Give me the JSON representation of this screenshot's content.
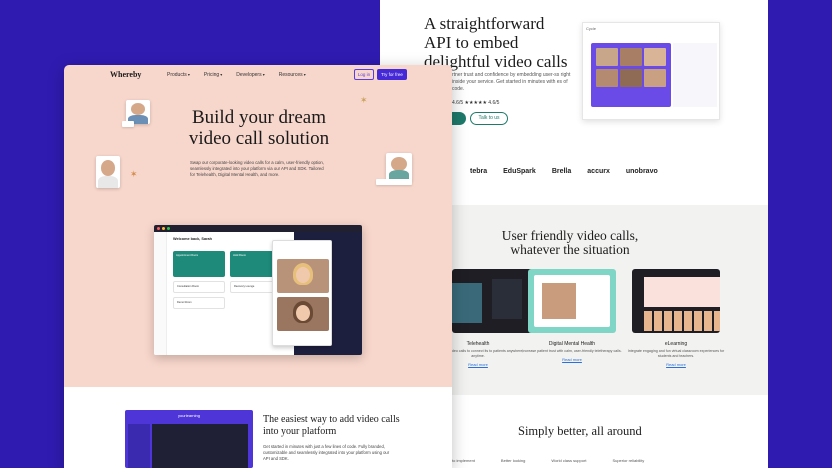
{
  "back_page": {
    "hero_title": "A straightforward API to embed delightful video calls",
    "hero_desc": "rtner trust and confidence by embedding user-ss right inside your service. Get started in minutes with es of code.",
    "rating": "4.6/5 ★★★★★ 4.6/5",
    "talk_button": "Talk to us",
    "demo_label": "Cycle",
    "logos": [
      "tebra",
      "EduSpark",
      "Brella",
      "accurx",
      "unobravo"
    ],
    "section_title": "User friendly video calls, whatever the situation",
    "cards": [
      {
        "title": "Telehealth",
        "desc": "e, reliable video calls to connect its to patients anywhere, anytime.",
        "link": "Read more"
      },
      {
        "title": "Digital Mental Health",
        "desc": "Increase patient trust with calm, user-friendly teletherapy calls.",
        "link": "Read more"
      },
      {
        "title": "eLearning",
        "desc": "Integrate engaging and fun virtual classroom experiences for students and teachers.",
        "link": "Read more"
      }
    ],
    "simply_title": "Simply better, all around",
    "bottom_items": [
      "easier to implement",
      "Better looking",
      "World class support",
      "Superior reliability"
    ]
  },
  "front_page": {
    "logo": "Whereby",
    "nav": [
      "Products",
      "Pricing",
      "Developers",
      "Resources"
    ],
    "login": "Log in",
    "try": "Try for free",
    "title": "Build your dream video call solution",
    "desc": "Swap our corporate-looking video calls for a calm, user-friendly option, seamlessly integrated into your platform via our API and SDK. Tailored for Telehealth, Digital Mental Health, and more.",
    "app": {
      "welcome": "Welcome back, Sarah",
      "rooms": [
        "Appointment Room",
        "Hold Room",
        "Consultation Room",
        "Recovery Lounge",
        "Demo Room"
      ]
    },
    "lower_title": "The easiest way to add video calls into your platform",
    "lower_desc": "Get started in minutes with just a few lines of code. Fully branded, customizable and seamlessly integrated into your platform using our API and SDK.",
    "code_title": "yourlearning"
  },
  "colors": {
    "brand_purple": "#2f1bb0",
    "peach": "#f7d6cb",
    "teal": "#1e8a7a"
  }
}
